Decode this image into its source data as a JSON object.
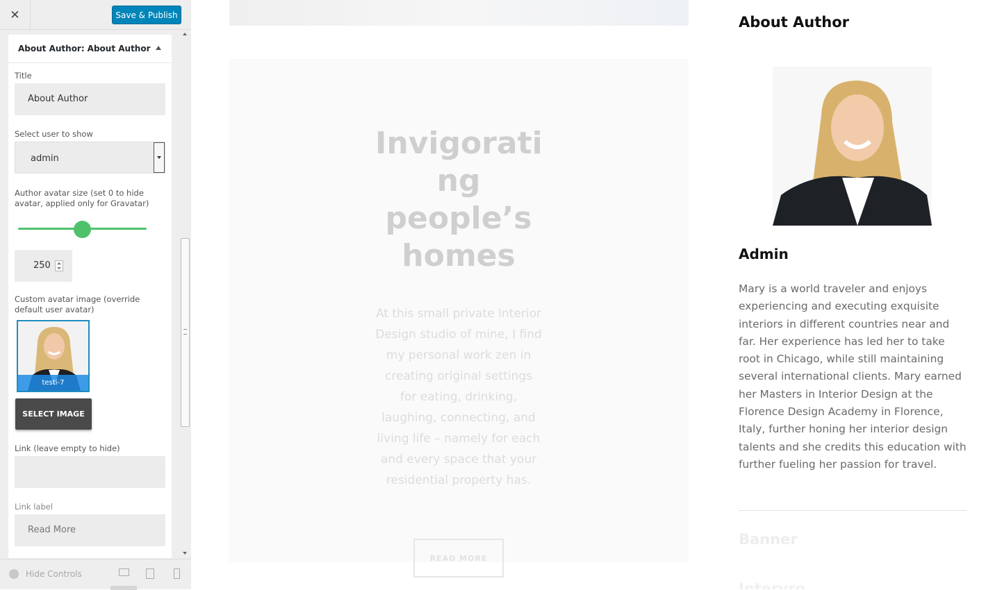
{
  "topbar": {
    "close_glyph": "✕",
    "publish_label": "Save & Publish"
  },
  "panel": {
    "header_prefix": "About Author:",
    "header_value": "About Author",
    "fields": {
      "title_label": "Title",
      "title_value": "About Author",
      "user_label": "Select user to show",
      "user_value": "admin",
      "avatar_size_label": "Author avatar size (set 0 to hide avatar, applied only for Gravatar)",
      "avatar_size_value": "250",
      "avatar_size_slider_fraction": 0.5,
      "custom_avatar_label": "Custom avatar image (override default user avatar)",
      "custom_avatar_caption": "testi-7",
      "select_image_label": "SELECT IMAGE",
      "link_label": "Link (leave empty to hide)",
      "link_value": "",
      "link_text_label": "Link label",
      "link_text_value": "Read More"
    }
  },
  "footer": {
    "hide_controls_label": "Hide Controls",
    "devices": [
      "desktop-icon",
      "tablet-icon",
      "mobile-icon"
    ]
  },
  "preview": {
    "headline": "Invigorati\nng\npeople’s\nhomes",
    "intro": "At this small private Interior Design studio of mine, I find my personal work zen in creating original settings for eating, drinking, laughing, connecting, and living life – namely for each and every space that your residential property has.",
    "read_more_label": "READ MORE",
    "widget_title": "About Author",
    "author_name": "Admin",
    "author_bio": "Mary is a world traveler and enjoys experiencing and executing exquisite interiors in different countries near and far. Her experience has led her to take root in Chicago, while still maintaining several international clients. Mary earned her Masters in Interior Design at the Florence Design Academy in Florence, Italy, further honing her interior design talents and she credits this education with further fueling her passion for travel.",
    "banner_title": "Banner",
    "next_title": "Intervro"
  },
  "colors": {
    "publish_blue": "#0085ba",
    "slider_green": "#4fc16b",
    "caption_blue": "#1e8ce6"
  }
}
